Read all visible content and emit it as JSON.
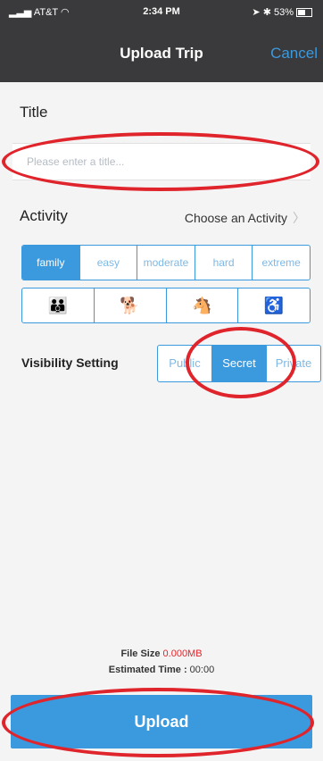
{
  "status_bar": {
    "carrier": "AT&T",
    "time": "2:34 PM",
    "battery": "53%"
  },
  "nav": {
    "title": "Upload Trip",
    "cancel": "Cancel"
  },
  "title_section": {
    "label": "Title",
    "placeholder": "Please enter a title..."
  },
  "activity": {
    "label": "Activity",
    "choose": "Choose an Activity"
  },
  "difficulty": {
    "options": [
      "family",
      "easy",
      "moderate",
      "hard",
      "extreme"
    ],
    "selected": "family"
  },
  "accessibility_icons": [
    "family-icon",
    "dog-icon",
    "pony-icon",
    "wheelchair-icon"
  ],
  "visibility": {
    "label": "Visibility Setting",
    "options": [
      "Public",
      "Secret",
      "Private"
    ],
    "selected": "Secret"
  },
  "file_info": {
    "size_label": "File Size",
    "size_value": "0.000MB",
    "time_label": "Estimated Time : ",
    "time_value": "00:00"
  },
  "upload": {
    "label": "Upload"
  },
  "colors": {
    "accent": "#3b99de",
    "annotation": "#e0242b",
    "navbar": "#3a3a3c"
  }
}
